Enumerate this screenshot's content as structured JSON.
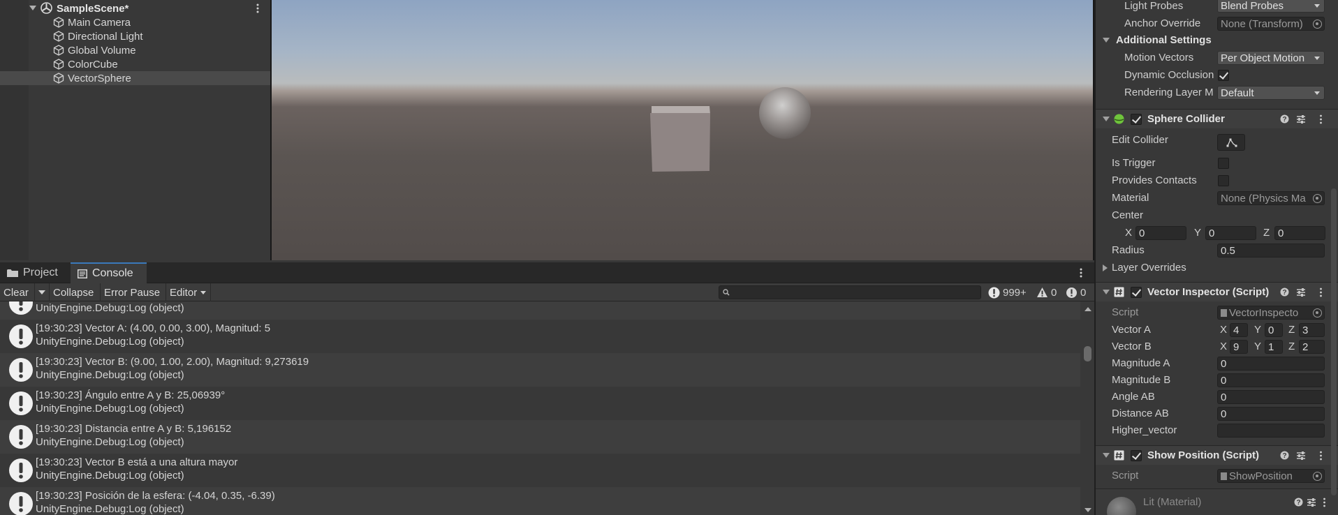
{
  "hierarchy": {
    "scene_name": "SampleScene*",
    "items": [
      {
        "label": "Main Camera"
      },
      {
        "label": "Directional Light"
      },
      {
        "label": "Global Volume"
      },
      {
        "label": "ColorCube"
      },
      {
        "label": "VectorSphere"
      }
    ]
  },
  "console": {
    "tabs": [
      {
        "label": "Project"
      },
      {
        "label": "Console"
      }
    ],
    "toolbar": {
      "clear": "Clear",
      "collapse": "Collapse",
      "error_pause": "Error Pause",
      "editor": "Editor",
      "search_value": ""
    },
    "counts": {
      "logs": "999+",
      "warnings": "0",
      "errors": "0"
    },
    "partial_top": "UnityEngine.Debug:Log (object)",
    "logs": [
      {
        "line1": "[19:30:23] Vector A: (4.00, 0.00, 3.00), Magnitud: 5",
        "line2": "UnityEngine.Debug:Log (object)"
      },
      {
        "line1": "[19:30:23] Vector B: (9.00, 1.00, 2.00), Magnitud: 9,273619",
        "line2": "UnityEngine.Debug:Log (object)"
      },
      {
        "line1": "[19:30:23] Ángulo entre A y B: 25,06939°",
        "line2": "UnityEngine.Debug:Log (object)"
      },
      {
        "line1": "[19:30:23] Distancia entre A y B: 5,196152",
        "line2": "UnityEngine.Debug:Log (object)"
      },
      {
        "line1": "[19:30:23] Vector B está a una altura mayor",
        "line2": "UnityEngine.Debug:Log (object)"
      },
      {
        "line1": "[19:30:23] Posición de la esfera: (-4.04, 0.35, -6.39)",
        "line2": "UnityEngine.Debug:Log (object)"
      }
    ]
  },
  "inspector": {
    "renderer": {
      "light_probes_label": "Light Probes",
      "light_probes_value": "Blend Probes",
      "anchor_override_label": "Anchor Override",
      "anchor_override_value": "None (Transform)",
      "additional_settings": "Additional Settings",
      "motion_vectors_label": "Motion Vectors",
      "motion_vectors_value": "Per Object Motion",
      "dynamic_occlusion_label": "Dynamic Occlusion",
      "dynamic_occlusion_checked": true,
      "rendering_layer_label": "Rendering Layer M",
      "rendering_layer_value": "Default"
    },
    "sphere_collider": {
      "title": "Sphere Collider",
      "edit_collider": "Edit Collider",
      "is_trigger": "Is Trigger",
      "provides_contacts": "Provides Contacts",
      "material_label": "Material",
      "material_value": "None (Physics Ma",
      "center_label": "Center",
      "center": {
        "x_label": "X",
        "x": "0",
        "y_label": "Y",
        "y": "0",
        "z_label": "Z",
        "z": "0"
      },
      "radius_label": "Radius",
      "radius": "0.5",
      "layer_overrides": "Layer Overrides"
    },
    "vector_inspector": {
      "title": "Vector Inspector (Script)",
      "script_label": "Script",
      "script_value": "VectorInspecto",
      "vector_a_label": "Vector A",
      "vector_a": {
        "x": "4",
        "y": "0",
        "z": "3"
      },
      "vector_b_label": "Vector B",
      "vector_b": {
        "x": "9",
        "y": "1",
        "z": "2"
      },
      "axis_labels": {
        "x": "X",
        "y": "Y",
        "z": "Z"
      },
      "magnitude_a_label": "Magnitude A",
      "magnitude_a": "0",
      "magnitude_b_label": "Magnitude B",
      "magnitude_b": "0",
      "angle_ab_label": "Angle AB",
      "angle_ab": "0",
      "distance_ab_label": "Distance AB",
      "distance_ab": "0",
      "higher_vector_label": "Higher_vector",
      "higher_vector": ""
    },
    "show_position": {
      "title": "Show Position (Script)",
      "script_label": "Script",
      "script_value": "ShowPosition"
    },
    "material": {
      "title": "Lit (Material)"
    }
  },
  "colors": {
    "panel_bg": "#383838",
    "header_bg": "#3e3e3e",
    "field_bg": "#2a2a2a",
    "accent": "#3a79bb",
    "sphere_collider_icon": "#6fc43c"
  },
  "icons": [
    "unity-scene-icon",
    "gameobject-cube-icon",
    "kebab-menu-icon",
    "folder-icon",
    "console-icon",
    "search-icon",
    "info-icon",
    "warning-icon",
    "error-icon",
    "help-icon",
    "settings-sliders-icon",
    "script-hash-icon",
    "object-picker-icon"
  ]
}
